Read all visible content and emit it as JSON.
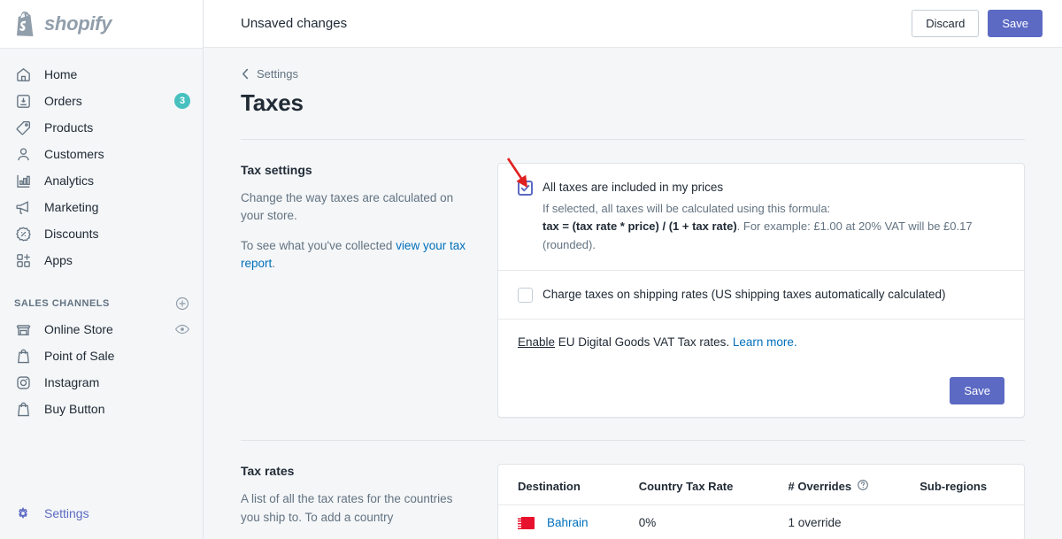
{
  "brand": {
    "name": "shopify",
    "accent": "#5c6ac4",
    "badge_color": "#47c1bf",
    "link_color": "#006fbb"
  },
  "sidebar": {
    "items": [
      {
        "label": "Home",
        "icon": "home-icon"
      },
      {
        "label": "Orders",
        "icon": "orders-icon",
        "badge": "3"
      },
      {
        "label": "Products",
        "icon": "tag-icon"
      },
      {
        "label": "Customers",
        "icon": "person-icon"
      },
      {
        "label": "Analytics",
        "icon": "bar-chart-icon"
      },
      {
        "label": "Marketing",
        "icon": "megaphone-icon"
      },
      {
        "label": "Discounts",
        "icon": "discount-icon"
      },
      {
        "label": "Apps",
        "icon": "apps-icon"
      }
    ],
    "section_title": "SALES CHANNELS",
    "add_channel_icon": "plus-circle-icon",
    "channels": [
      {
        "label": "Online Store",
        "icon": "storefront-icon",
        "trailing_icon": "eye-icon"
      },
      {
        "label": "Point of Sale",
        "icon": "shopify-bag-icon"
      },
      {
        "label": "Instagram",
        "icon": "instagram-icon"
      },
      {
        "label": "Buy Button",
        "icon": "shopify-bag-icon"
      }
    ],
    "settings": {
      "label": "Settings",
      "icon": "gear-icon"
    }
  },
  "topbar": {
    "title": "Unsaved changes",
    "discard_label": "Discard",
    "save_label": "Save"
  },
  "page": {
    "breadcrumb": "Settings",
    "title": "Taxes"
  },
  "tax_settings": {
    "heading": "Tax settings",
    "desc1": "Change the way taxes are calculated on your store.",
    "desc2_prefix": "To see what you've collected ",
    "desc2_link": "view your tax report",
    "desc2_suffix": ".",
    "included_checkbox": {
      "label": "All taxes are included in my prices",
      "checked": true,
      "helper_line1": "If selected, all taxes will be calculated using this formula:",
      "helper_formula": "tax = (tax rate * price) / (1 + tax rate)",
      "helper_line2": ". For example: £1.00 at 20% VAT will be £0.17 (rounded)."
    },
    "shipping_checkbox": {
      "label": "Charge taxes on shipping rates (US shipping taxes automatically calculated)",
      "checked": false
    },
    "eu_vat": {
      "enable_label": "Enable",
      "text": " EU Digital Goods VAT Tax rates. ",
      "learn_more": "Learn more."
    },
    "save_label": "Save"
  },
  "tax_rates": {
    "heading": "Tax rates",
    "desc": "A list of all the tax rates for the countries you ship to. To add a country",
    "columns": [
      "Destination",
      "Country Tax Rate",
      "# Overrides",
      "Sub-regions"
    ],
    "overrides_help_icon": "question-circle-icon",
    "rows": [
      {
        "destination": "Bahrain",
        "flag": "bahrain-flag",
        "country_tax_rate": "0%",
        "overrides": "1 override",
        "sub_regions": ""
      }
    ]
  },
  "annotation": {
    "arrow_color": "#e02020",
    "points_to": "All taxes are included in my prices checkbox"
  }
}
